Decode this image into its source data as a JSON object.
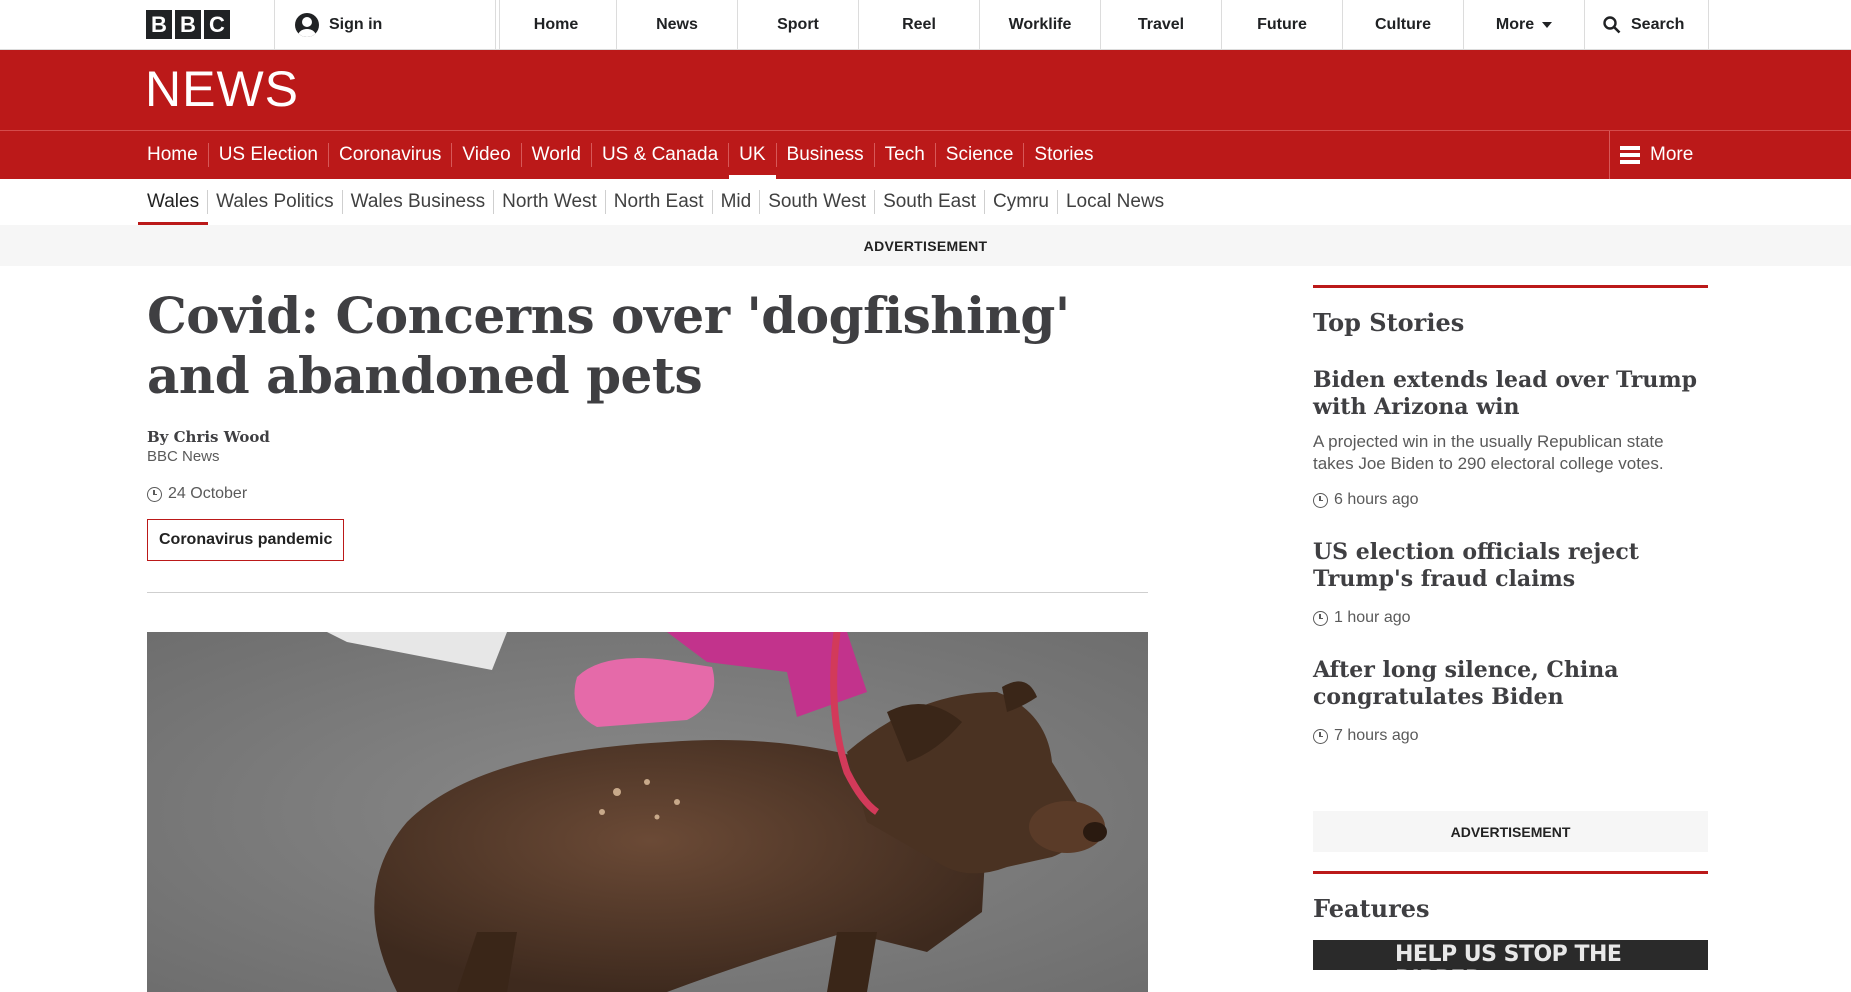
{
  "global_nav": {
    "logo_letters": [
      "B",
      "B",
      "C"
    ],
    "sign_in": "Sign in",
    "items": [
      "Home",
      "News",
      "Sport",
      "Reel",
      "Worklife",
      "Travel",
      "Future",
      "Culture"
    ],
    "more": "More",
    "search": "Search"
  },
  "masthead": {
    "brand": "NEWS"
  },
  "news_nav": {
    "items": [
      "Home",
      "US Election",
      "Coronavirus",
      "Video",
      "World",
      "US & Canada",
      "UK",
      "Business",
      "Tech",
      "Science",
      "Stories"
    ],
    "active": "UK",
    "more": "More"
  },
  "sub_nav": {
    "items": [
      "Wales",
      "Wales Politics",
      "Wales Business",
      "North West",
      "North East",
      "Mid",
      "South West",
      "South East",
      "Cymru",
      "Local News"
    ],
    "active": "Wales"
  },
  "advert_label": "ADVERTISEMENT",
  "article": {
    "headline": "Covid: Concerns over 'dogfishing' and abandoned pets",
    "author": "By Chris Wood",
    "author_org": "BBC News",
    "date": "24 October",
    "tag": "Coronavirus pandemic"
  },
  "sidebar": {
    "top_stories_title": "Top Stories",
    "stories": [
      {
        "title": "Biden extends lead over Trump with Arizona win",
        "summary": "A projected win in the usually Republican state takes Joe Biden to 290 electoral college votes.",
        "time": "6 hours ago"
      },
      {
        "title": "US election officials reject Trump's fraud claims",
        "summary": "",
        "time": "1 hour ago"
      },
      {
        "title": "After long silence, China congratulates Biden",
        "summary": "",
        "time": "7 hours ago"
      }
    ],
    "advert_label": "ADVERTISEMENT",
    "features_title": "Features",
    "feature_thumb_text": "HELP US STOP THE RIPPER"
  },
  "colors": {
    "brand_red": "#bb1919",
    "text_dark": "#3f3f42"
  }
}
